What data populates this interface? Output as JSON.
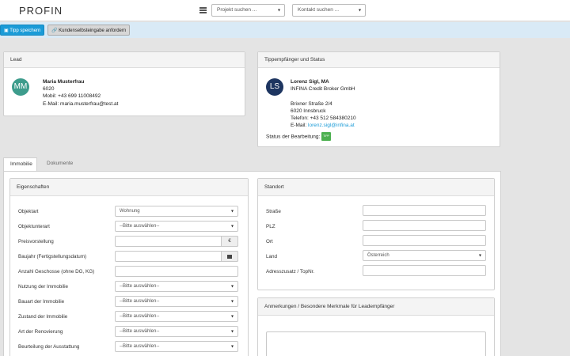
{
  "header": {
    "logo": "PROFIN",
    "project_search": "Projekt suchen ...",
    "contact_search": "Kontakt suchen ..."
  },
  "actions": {
    "save_label": "Tipp speichern",
    "request_label": "Kundenselbsteingabe anfordern"
  },
  "lead": {
    "title": "Lead",
    "initials": "MM",
    "name": "Maria Musterfrau",
    "zip": "6020",
    "mobile": "Mobil: +43 699 11008492",
    "email": "E-Mail: maria.musterfrau@test.at"
  },
  "recipient": {
    "title": "Tippempfänger und Status",
    "initials": "LS",
    "name": "Lorenz Sigl, MA",
    "company": "INFINA Credit Broker GmbH",
    "street": "Brixner Straße 2/4",
    "city": "6020 Innsbruck",
    "phone": "Telefon: +43 512 584380210",
    "email_label": "E-Mail: ",
    "email": "lorenz.sigl@infina.at",
    "status_label": "Status der Bearbeitung:",
    "status_badge": "TIPP"
  },
  "tabs": {
    "property": "Immobilie",
    "documents": "Dokumente"
  },
  "properties": {
    "title": "Eigenschaften",
    "objektart_label": "Objektart",
    "objektart_value": "Wohnung",
    "objektunterart_label": "Objektunterart",
    "objektunterart_value": "--Bitte auswählen--",
    "preis_label": "Preisvorstellung",
    "preis_addon": "€",
    "baujahr_label": "Baujahr (Fertigstellungsdatum)",
    "geschosse_label": "Anzahl Geschosse (ohne DG, KG)",
    "nutzung_label": "Nutzung der Immobilie",
    "nutzung_value": "--Bitte auswählen--",
    "bauart_label": "Bauart der Immobilie",
    "bauart_value": "--Bitte auswählen--",
    "zustand_label": "Zustand der Immobilie",
    "zustand_value": "--Bitte auswählen--",
    "renovierung_label": "Art der Renovierung",
    "renovierung_value": "--Bitte auswählen--",
    "ausstattung_label": "Beurteilung der Ausstattung",
    "ausstattung_value": "--Bitte auswählen--"
  },
  "location": {
    "title": "Standort",
    "street_label": "Straße",
    "zip_label": "PLZ",
    "city_label": "Ort",
    "country_label": "Land",
    "country_value": "Österreich",
    "address_extra_label": "Adresszusatz / TopNr."
  },
  "notes": {
    "title": "Anmerkungen / Besondere Merkmale für Leadempfänger"
  }
}
